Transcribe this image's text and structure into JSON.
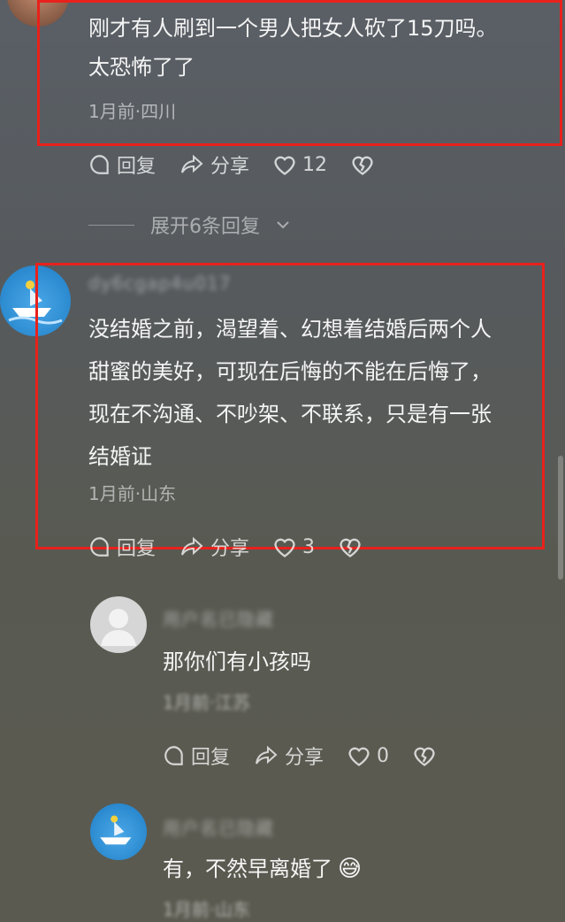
{
  "comment1": {
    "text_line1": "刚才有人刷到一个男人把女人砍了15刀吗。",
    "text_line2": "太恐怖了了",
    "meta": "1月前·四川",
    "reply_label": "回复",
    "share_label": "分享",
    "like_count": "12"
  },
  "expand_replies": {
    "label": "展开6条回复"
  },
  "comment2": {
    "username": "dy6cgap4u017",
    "text_line1": "没结婚之前，渴望着、幻想着结婚后两个人",
    "text_line2": "甜蜜的美好，可现在后悔的不能在后悔了，",
    "text_line3": "现在不沟通、不吵架、不联系，只是有一张",
    "text_line4": "结婚证",
    "meta": "1月前·山东",
    "reply_label": "回复",
    "share_label": "分享",
    "like_count": "3"
  },
  "reply1": {
    "username": "用户名已隐藏",
    "text": "那你们有小孩吗",
    "meta": "1月前·江苏",
    "reply_label": "回复",
    "share_label": "分享",
    "like_count": "0"
  },
  "reply2": {
    "username": "用户名已隐藏",
    "text": "有，不然早离婚了",
    "emoji": "😅",
    "meta": "1月前·山东"
  },
  "colors": {
    "highlight_border": "#e8211c",
    "text": "#f4f4f4",
    "muted": "#a8a8a8"
  }
}
